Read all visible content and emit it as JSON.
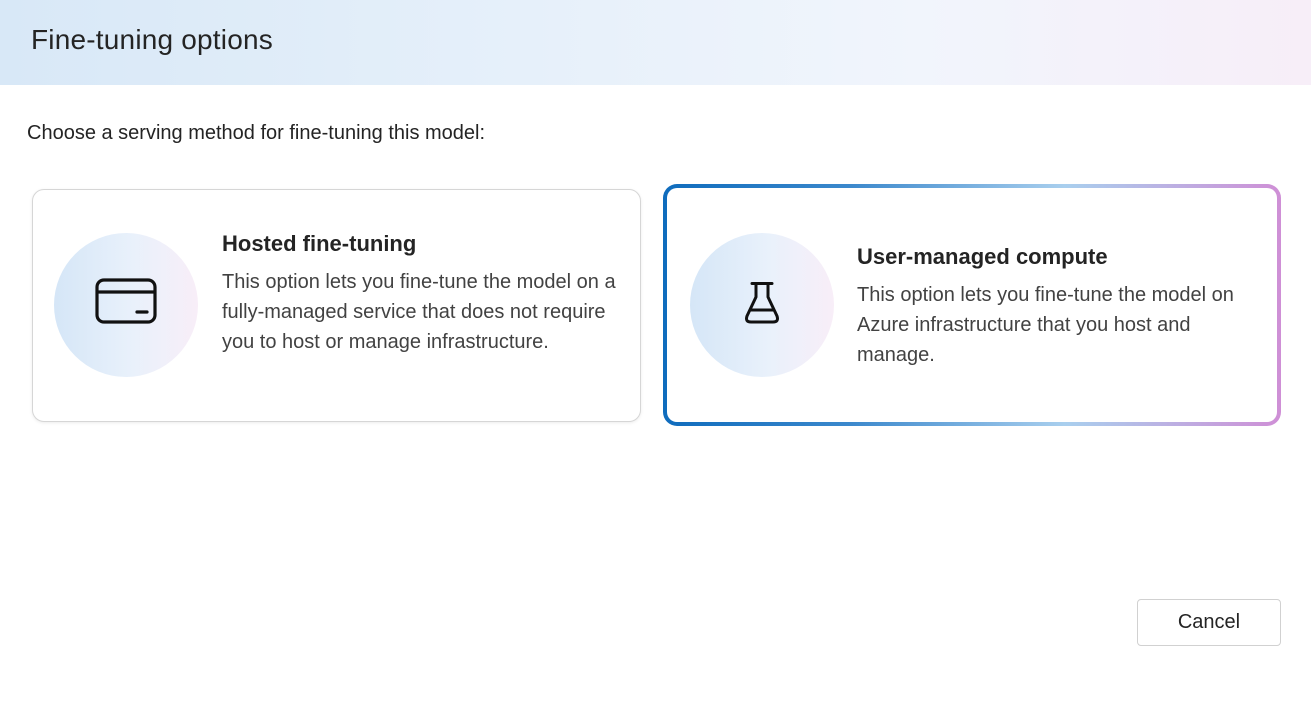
{
  "dialog": {
    "title": "Fine-tuning options",
    "subtitle": "Choose a serving method for fine-tuning this model:"
  },
  "options": [
    {
      "id": "hosted",
      "title": "Hosted fine-tuning",
      "description": "This option lets you fine-tune the model on a fully-managed service that does not require you to host or manage infrastructure.",
      "icon": "credit-card-icon",
      "selected": false
    },
    {
      "id": "user-managed",
      "title": "User-managed compute",
      "description": "This option lets you fine-tune the model on Azure infrastructure that you host and manage.",
      "icon": "beaker-icon",
      "selected": true
    }
  ],
  "footer": {
    "cancel_label": "Cancel"
  },
  "colors": {
    "selected_border_start": "#0f6cbd",
    "selected_border_end": "#cf8fd6",
    "header_gradient_start": "#d8e8f7",
    "header_gradient_end": "#f7eef8"
  }
}
